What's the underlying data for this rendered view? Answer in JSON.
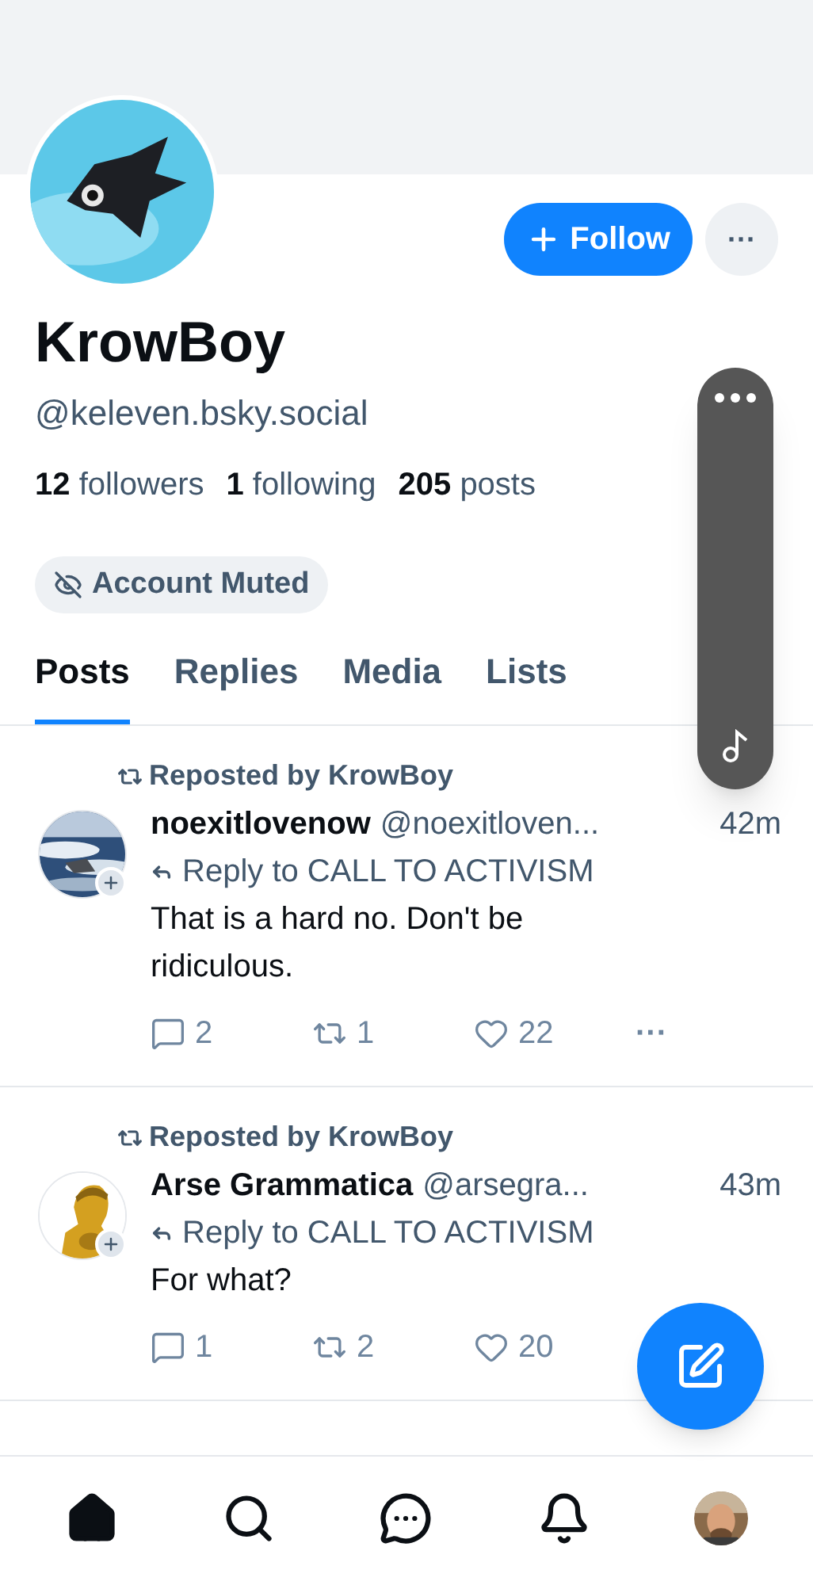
{
  "profile": {
    "name": "KrowBoy",
    "handle": "@keleven.bsky.social",
    "stats": [
      {
        "count": "12",
        "label": "followers"
      },
      {
        "count": "1",
        "label": "following"
      },
      {
        "count": "205",
        "label": "posts"
      }
    ],
    "follow_button": "Follow",
    "more_button": "···",
    "badge": "Account Muted"
  },
  "tabs": [
    {
      "label": "Posts",
      "selected": true
    },
    {
      "label": "Replies",
      "selected": false
    },
    {
      "label": "Media",
      "selected": false
    },
    {
      "label": "Lists",
      "selected": false
    }
  ],
  "posts": [
    {
      "reposted_by": "Reposted by KrowBoy",
      "author": "noexitlovenow",
      "handle": "@noexitloven...",
      "time": "42m",
      "reply_to": "Reply to CALL TO ACTIVISM",
      "text": "That is a hard no. Don't be ridiculous.",
      "replies": "2",
      "reposts": "1",
      "likes": "22",
      "more": "···"
    },
    {
      "reposted_by": "Reposted by KrowBoy",
      "author": "Arse Grammatica",
      "handle": "@arsegra...",
      "time": "43m",
      "reply_to": "Reply to CALL TO ACTIVISM",
      "text": "For what?",
      "replies": "1",
      "reposts": "2",
      "likes": "20"
    }
  ],
  "nav": [
    {
      "kind": "home",
      "selected": true
    },
    {
      "kind": "search",
      "selected": false
    },
    {
      "kind": "chat",
      "selected": false
    },
    {
      "kind": "bell",
      "selected": false
    },
    {
      "kind": "avatar",
      "selected": false
    }
  ]
}
